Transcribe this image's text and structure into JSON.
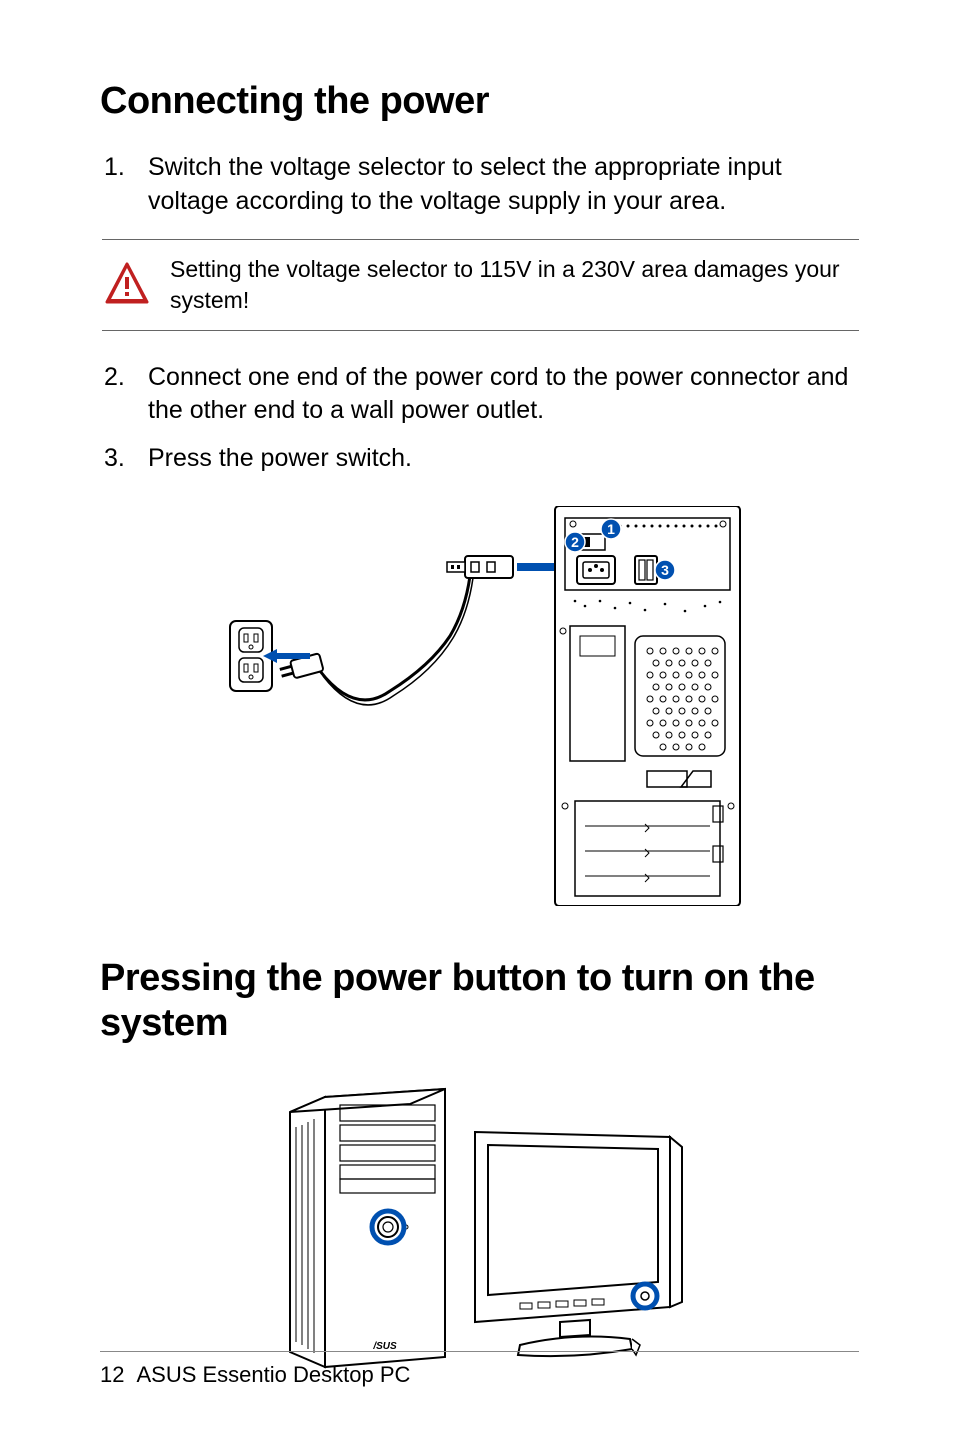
{
  "heading1": "Connecting the power",
  "list1": {
    "item1_num": "1.",
    "item1_text": "Switch the voltage selector to select the appropriate input voltage according to the voltage supply in your area."
  },
  "caution": {
    "text": "Setting the voltage selector to 115V in a 230V area damages your system!"
  },
  "list2": {
    "item2_num": "2.",
    "item2_text": "Connect one end of the power cord to the power connector and the other end to a wall power outlet.",
    "item3_num": "3.",
    "item3_text": "Press the power switch."
  },
  "figure1": {
    "callout1": "1",
    "callout2": "2",
    "callout3": "3"
  },
  "heading2": "Pressing the power button to turn on the system",
  "footer": {
    "page": "12",
    "product": "ASUS Essentio Desktop PC"
  }
}
